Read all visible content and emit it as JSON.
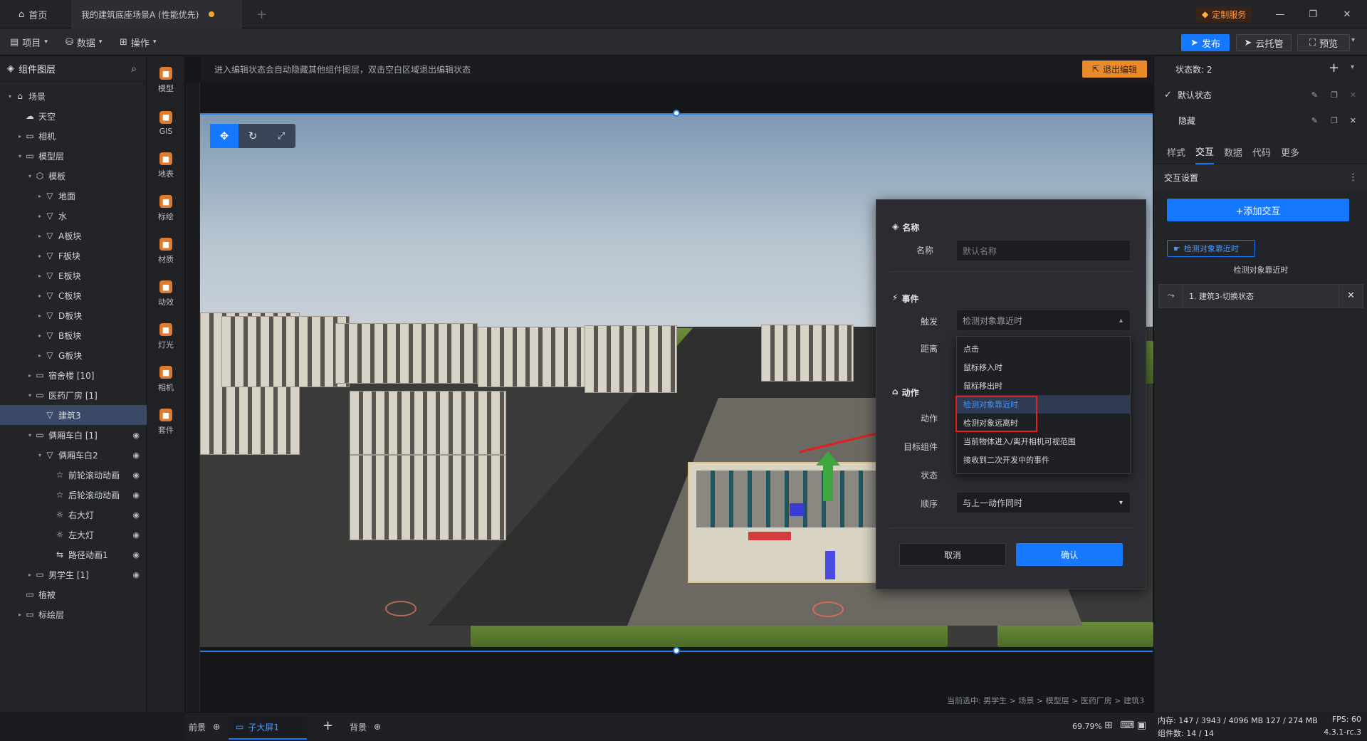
{
  "titlebar": {
    "home_label": "首页",
    "active_tab": "我的建筑底座场景A (性能优先)",
    "add_tab": "+",
    "custom_service": "定制服务",
    "minimize": "—",
    "restore": "❐",
    "close": "✕"
  },
  "menubar": {
    "items": [
      "项目",
      "数据",
      "操作"
    ],
    "publish": "发布",
    "cloud": "云托管",
    "preview": "预览"
  },
  "layers": {
    "title": "组件图层",
    "items": [
      {
        "label": "场景",
        "icon": "⌂",
        "arrow": "▾",
        "indent": 0
      },
      {
        "label": "天空",
        "icon": "☁",
        "arrow": "",
        "indent": 1
      },
      {
        "label": "相机",
        "icon": "▭",
        "arrow": "▸",
        "indent": 1
      },
      {
        "label": "模型层",
        "icon": "▭",
        "arrow": "▾",
        "indent": 1
      },
      {
        "label": "模板",
        "icon": "⬡",
        "arrow": "▾",
        "indent": 2
      },
      {
        "label": "地面",
        "icon": "▽",
        "arrow": "▸",
        "indent": 3
      },
      {
        "label": "水",
        "icon": "▽",
        "arrow": "▸",
        "indent": 3
      },
      {
        "label": "A板块",
        "icon": "▽",
        "arrow": "▸",
        "indent": 3
      },
      {
        "label": "F板块",
        "icon": "▽",
        "arrow": "▸",
        "indent": 3
      },
      {
        "label": "E板块",
        "icon": "▽",
        "arrow": "▸",
        "indent": 3
      },
      {
        "label": "C板块",
        "icon": "▽",
        "arrow": "▸",
        "indent": 3
      },
      {
        "label": "D板块",
        "icon": "▽",
        "arrow": "▸",
        "indent": 3
      },
      {
        "label": "B板块",
        "icon": "▽",
        "arrow": "▸",
        "indent": 3
      },
      {
        "label": "G板块",
        "icon": "▽",
        "arrow": "▸",
        "indent": 3
      },
      {
        "label": "宿舍楼 [10]",
        "icon": "▭",
        "arrow": "▸",
        "indent": 2
      },
      {
        "label": "医药厂房 [1]",
        "icon": "▭",
        "arrow": "▾",
        "indent": 2
      },
      {
        "label": "建筑3",
        "icon": "▽",
        "arrow": "",
        "indent": 3,
        "selected": true
      },
      {
        "label": "俩厢车白 [1]",
        "icon": "▭",
        "arrow": "▾",
        "indent": 2,
        "eye": true
      },
      {
        "label": "俩厢车白2",
        "icon": "▽",
        "arrow": "▾",
        "indent": 3,
        "eye": true
      },
      {
        "label": "前轮滚动动画",
        "icon": "☆",
        "arrow": "",
        "indent": 4,
        "eye": true
      },
      {
        "label": "后轮滚动动画",
        "icon": "☆",
        "arrow": "",
        "indent": 4,
        "eye": true
      },
      {
        "label": "右大灯",
        "icon": "☼",
        "arrow": "",
        "indent": 4,
        "eye": true
      },
      {
        "label": "左大灯",
        "icon": "☼",
        "arrow": "",
        "indent": 4,
        "eye": true
      },
      {
        "label": "路径动画1",
        "icon": "⇆",
        "arrow": "",
        "indent": 4,
        "eye": true
      },
      {
        "label": "男学生 [1]",
        "icon": "▭",
        "arrow": "▸",
        "indent": 2,
        "eye": true
      },
      {
        "label": "植被",
        "icon": "▭",
        "arrow": "",
        "indent": 1
      },
      {
        "label": "标绘层",
        "icon": "▭",
        "arrow": "▸",
        "indent": 1
      }
    ]
  },
  "tools": [
    {
      "label": "模型",
      "color": "#e07b2e"
    },
    {
      "label": "GIS",
      "color": "#e07b2e"
    },
    {
      "label": "地表",
      "color": "#e07b2e"
    },
    {
      "label": "标绘",
      "color": "#e07b2e"
    },
    {
      "label": "材质",
      "color": "#e07b2e"
    },
    {
      "label": "动效",
      "color": "#e07b2e"
    },
    {
      "label": "灯光",
      "color": "#e07b2e"
    },
    {
      "label": "相机",
      "color": "#e07b2e"
    },
    {
      "label": "套件",
      "color": "#e07b2e"
    }
  ],
  "canvas": {
    "hint": "进入编辑状态会自动隐藏其他组件图层，双击空白区域退出编辑状态",
    "exit_edit": "退出编辑",
    "breadcrumb": "当前选中: 男学生 > 场景 > 模型层 > 医药厂房 > 建筑3"
  },
  "dialog": {
    "section_name": "名称",
    "name_label": "名称",
    "name_placeholder": "默认名称",
    "section_event": "事件",
    "trigger_label": "触发",
    "trigger_value": "检测对象靠近时",
    "distance_label": "距离",
    "section_action": "动作",
    "action_label": "动作",
    "target_label": "目标组件",
    "state_label": "状态",
    "order_label": "顺序",
    "order_value": "与上一动作同时",
    "cancel": "取消",
    "confirm": "确认"
  },
  "dropdown": {
    "options": [
      "点击",
      "鼠标移入时",
      "鼠标移出时",
      "检测对象靠近时",
      "检测对象远离时",
      "当前物体进入/离开相机可视范围",
      "接收到二次开发中的事件"
    ]
  },
  "right": {
    "state_count": "状态数: 2",
    "states": [
      "默认状态",
      "隐藏"
    ],
    "tabs": [
      "样式",
      "交互",
      "数据",
      "代码",
      "更多"
    ],
    "section": "交互设置",
    "add_interaction": "+添加交互",
    "event_tag": "检测对象靠近时",
    "event_title": "检测对象靠近时",
    "action_item": "1. 建筑3-切换状态"
  },
  "bottom": {
    "front": "前景",
    "screen": "子大屏1",
    "back": "背景",
    "zoom": "69.79%"
  },
  "status": {
    "memory": "内存: 147 / 3943 / 4096 MB  127 / 274 MB",
    "fps": "FPS: 60",
    "components": "组件数: 14 / 14",
    "version": "4.3.1-rc.3"
  },
  "colors": {
    "accent": "#1677ff",
    "orange": "#f5a623",
    "danger": "#e02020"
  }
}
